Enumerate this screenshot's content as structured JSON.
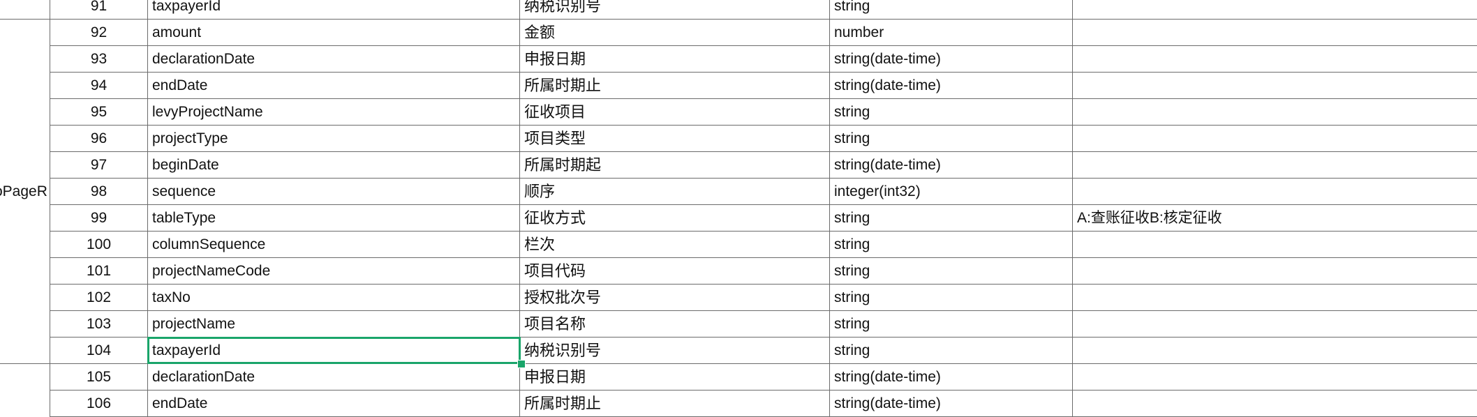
{
  "sheet": {
    "group_label": "oPageR",
    "selected_cell": {
      "row_no": "104",
      "column": "field_name"
    },
    "accent_color": "#1aa56a",
    "rows": [
      {
        "no": "91",
        "field": "taxpayerId",
        "desc": "纳税识别号",
        "type": "string",
        "note": ""
      },
      {
        "no": "92",
        "field": "amount",
        "desc": "金额",
        "type": "number",
        "note": ""
      },
      {
        "no": "93",
        "field": "declarationDate",
        "desc": "申报日期",
        "type": "string(date-time)",
        "note": ""
      },
      {
        "no": "94",
        "field": "endDate",
        "desc": "所属时期止",
        "type": "string(date-time)",
        "note": ""
      },
      {
        "no": "95",
        "field": "levyProjectName",
        "desc": "征收项目",
        "type": "string",
        "note": ""
      },
      {
        "no": "96",
        "field": "projectType",
        "desc": "项目类型",
        "type": "string",
        "note": ""
      },
      {
        "no": "97",
        "field": "beginDate",
        "desc": "所属时期起",
        "type": "string(date-time)",
        "note": ""
      },
      {
        "no": "98",
        "field": "sequence",
        "desc": "顺序",
        "type": "integer(int32)",
        "note": ""
      },
      {
        "no": "99",
        "field": "tableType",
        "desc": "征收方式",
        "type": "string",
        "note": "A:查账征收B:核定征收"
      },
      {
        "no": "100",
        "field": "columnSequence",
        "desc": "栏次",
        "type": "string",
        "note": ""
      },
      {
        "no": "101",
        "field": "projectNameCode",
        "desc": "项目代码",
        "type": "string",
        "note": ""
      },
      {
        "no": "102",
        "field": "taxNo",
        "desc": "授权批次号",
        "type": "string",
        "note": ""
      },
      {
        "no": "103",
        "field": "projectName",
        "desc": "项目名称",
        "type": "string",
        "note": ""
      },
      {
        "no": "104",
        "field": "taxpayerId",
        "desc": "纳税识别号",
        "type": "string",
        "note": ""
      },
      {
        "no": "105",
        "field": "declarationDate",
        "desc": "申报日期",
        "type": "string(date-time)",
        "note": ""
      },
      {
        "no": "106",
        "field": "endDate",
        "desc": "所属时期止",
        "type": "string(date-time)",
        "note": ""
      }
    ]
  }
}
